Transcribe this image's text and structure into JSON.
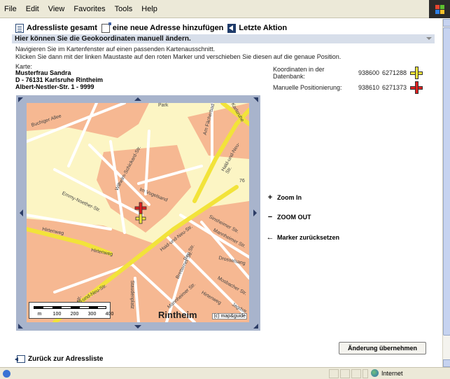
{
  "menubar": {
    "items": [
      "File",
      "Edit",
      "View",
      "Favorites",
      "Tools",
      "Help"
    ]
  },
  "toolbar": {
    "address_list": "Adressliste gesamt",
    "new_address": "eine neue Adresse hinzufügen",
    "last_action": "Letzte Aktion"
  },
  "header": {
    "title": "Hier können Sie die Geokoordinaten manuell ändern."
  },
  "instructions": {
    "line1": "Navigieren Sie im Kartenfenster auf einen passenden Kartenausschnitt.",
    "line2": "Klicken Sie dann mit der linken Maustaste auf den roten Marker und verschieben Sie diesen auf die genaue Position."
  },
  "card": {
    "label": "Karte:",
    "name": "Musterfrau Sandra",
    "city": "D - 76131 Karlsruhe Rintheim",
    "street": "Albert-Nestler-Str. 1 - 9999"
  },
  "coords": {
    "db_label": "Koordinaten in der Datenbank:",
    "db_x": "938600",
    "db_y": "6271288",
    "manual_label": "Manuelle Positionierung:",
    "manual_x": "938610",
    "manual_y": "6271373",
    "db_marker_color": "#f5e63c",
    "manual_marker_color": "#e02020"
  },
  "map": {
    "streets": [
      "Buchiger Allee",
      "Park",
      "Karlsruhe",
      "Am Fächerbad",
      "Hald-und-Neu-Str.",
      "Wilhelm-Schickard-Str.",
      "Emmy-Noether-Str.",
      "Im Vogelsand",
      "Hirtenweg",
      "Hirtenweg",
      "Haid-und-Neu-Str.",
      "Sinsheimer Str.",
      "Mannheimer Str.",
      "Hald-und-Neu-Str.",
      "Bretterner Str.",
      "Ren Str.",
      "Drosselsang",
      "Mosbacher Str.",
      "Hirtenweg",
      "Jagdstr.",
      "Staudenplatz",
      "Forststr.",
      "Mannheimer Str."
    ],
    "district": "Rintheim",
    "number_label": "76",
    "scale_ticks": [
      "m",
      "100",
      "200",
      "300",
      "400"
    ],
    "copyright": "(c) map&guide",
    "land_color": "#f6b892",
    "road_color": "#f2e33a"
  },
  "actions": {
    "zoom_in": "Zoom In",
    "zoom_out": "ZOOM OUT",
    "reset_marker": "Marker zurücksetzen",
    "zoom_in_symbol": "+",
    "zoom_out_symbol": "−",
    "reset_symbol": "←"
  },
  "buttons": {
    "apply": "Änderung übernehmen"
  },
  "links": {
    "back": "Zurück zur Adressliste"
  },
  "statusbar": {
    "zone": "Internet"
  }
}
